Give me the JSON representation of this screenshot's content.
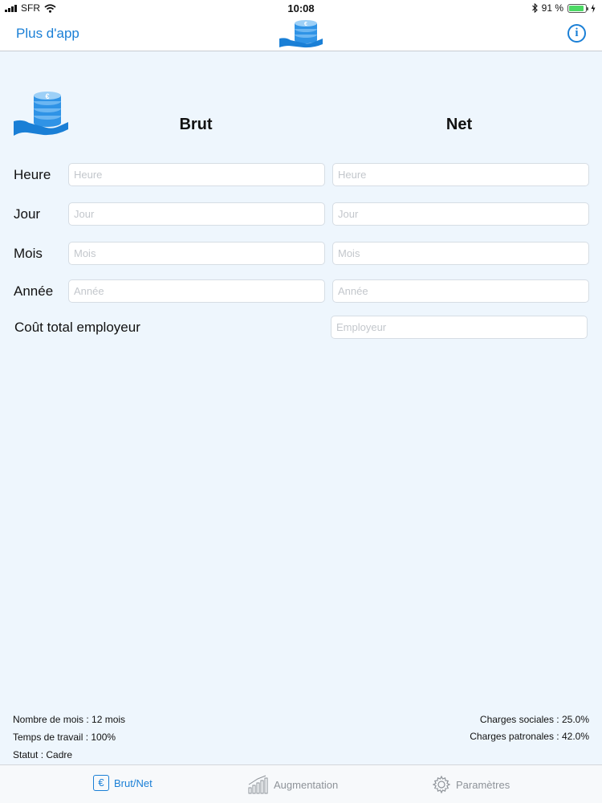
{
  "status_bar": {
    "carrier": "SFR",
    "time": "10:08",
    "battery_text": "91 %",
    "battery_level": 0.91
  },
  "nav": {
    "back_link": "Plus d'app",
    "info_icon": "info-icon",
    "logo_icon": "coins-hand-icon"
  },
  "columns": {
    "brut": "Brut",
    "net": "Net"
  },
  "rows": [
    {
      "label": "Heure",
      "brut_placeholder": "Heure",
      "net_placeholder": "Heure"
    },
    {
      "label": "Jour",
      "brut_placeholder": "Jour",
      "net_placeholder": "Jour"
    },
    {
      "label": "Mois",
      "brut_placeholder": "Mois",
      "net_placeholder": "Mois"
    },
    {
      "label": "Année",
      "brut_placeholder": "Année",
      "net_placeholder": "Année"
    }
  ],
  "employer": {
    "label": "Coût total employeur",
    "placeholder": "Employeur"
  },
  "info": {
    "months": "Nombre de mois : 12 mois",
    "work_time": "Temps de travail : 100%",
    "status": "Statut : Cadre",
    "social_charges": "Charges sociales : 25.0%",
    "employer_charges": "Charges patronales : 42.0%"
  },
  "tabs": [
    {
      "label": "Brut/Net",
      "icon": "euro-icon",
      "active": true
    },
    {
      "label": "Augmentation",
      "icon": "bar-chart-icon",
      "active": false
    },
    {
      "label": "Paramètres",
      "icon": "gear-icon",
      "active": false
    }
  ],
  "colors": {
    "accent": "#1a7fd6",
    "background": "#eef6fd",
    "battery": "#4cd964"
  }
}
